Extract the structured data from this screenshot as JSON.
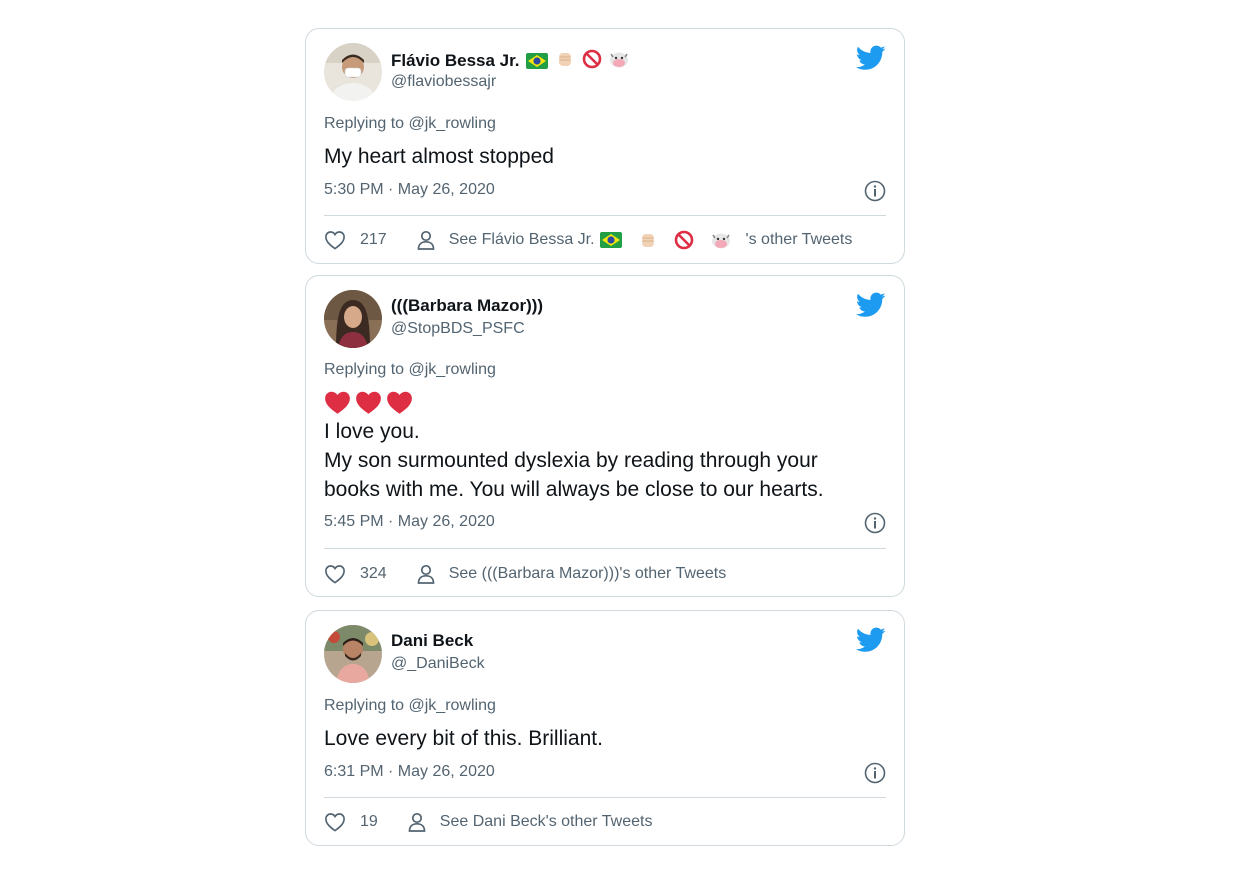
{
  "tweets": [
    {
      "name": "Flávio Bessa Jr.",
      "name_emojis": [
        "brazil-flag",
        "raised-fist",
        "prohibited-sign",
        "cow-face"
      ],
      "handle": "@flaviobessajr",
      "replying_to": "Replying to @jk_rowling",
      "body_lines": [
        "My heart almost stopped"
      ],
      "timestamp": "5:30 PM · May 26, 2020",
      "likes": "217",
      "see_prefix": "See Flávio Bessa Jr.",
      "see_suffix": "'s other Tweets"
    },
    {
      "name": "(((Barbara Mazor)))",
      "handle": "@StopBDS_PSFC",
      "replying_to": "Replying to @jk_rowling",
      "body_emojis": [
        "red-heart",
        "red-heart",
        "red-heart"
      ],
      "body_lines": [
        "I love you.",
        "My son surmounted dyslexia by reading through your",
        "books  with me. You will always be close to our hearts."
      ],
      "timestamp": "5:45 PM · May 26, 2020",
      "likes": "324",
      "see_text": "See (((Barbara Mazor)))'s other Tweets"
    },
    {
      "name": "Dani Beck",
      "handle": "@_DaniBeck",
      "replying_to": "Replying to @jk_rowling",
      "body_lines": [
        "Love every bit of this. Brilliant."
      ],
      "timestamp": "6:31 PM · May 26, 2020",
      "likes": "19",
      "see_text": "See Dani Beck's other Tweets"
    }
  ],
  "icons": {
    "brand": "twitter-bird-icon",
    "info": "info-icon",
    "like": "heart-outline-icon",
    "profile": "person-icon"
  },
  "colors": {
    "twitter_blue": "#1d9bf0",
    "text_primary": "#0f1419",
    "text_secondary": "#536471",
    "border": "#cfd9de",
    "heart_red": "#dd2e44"
  }
}
